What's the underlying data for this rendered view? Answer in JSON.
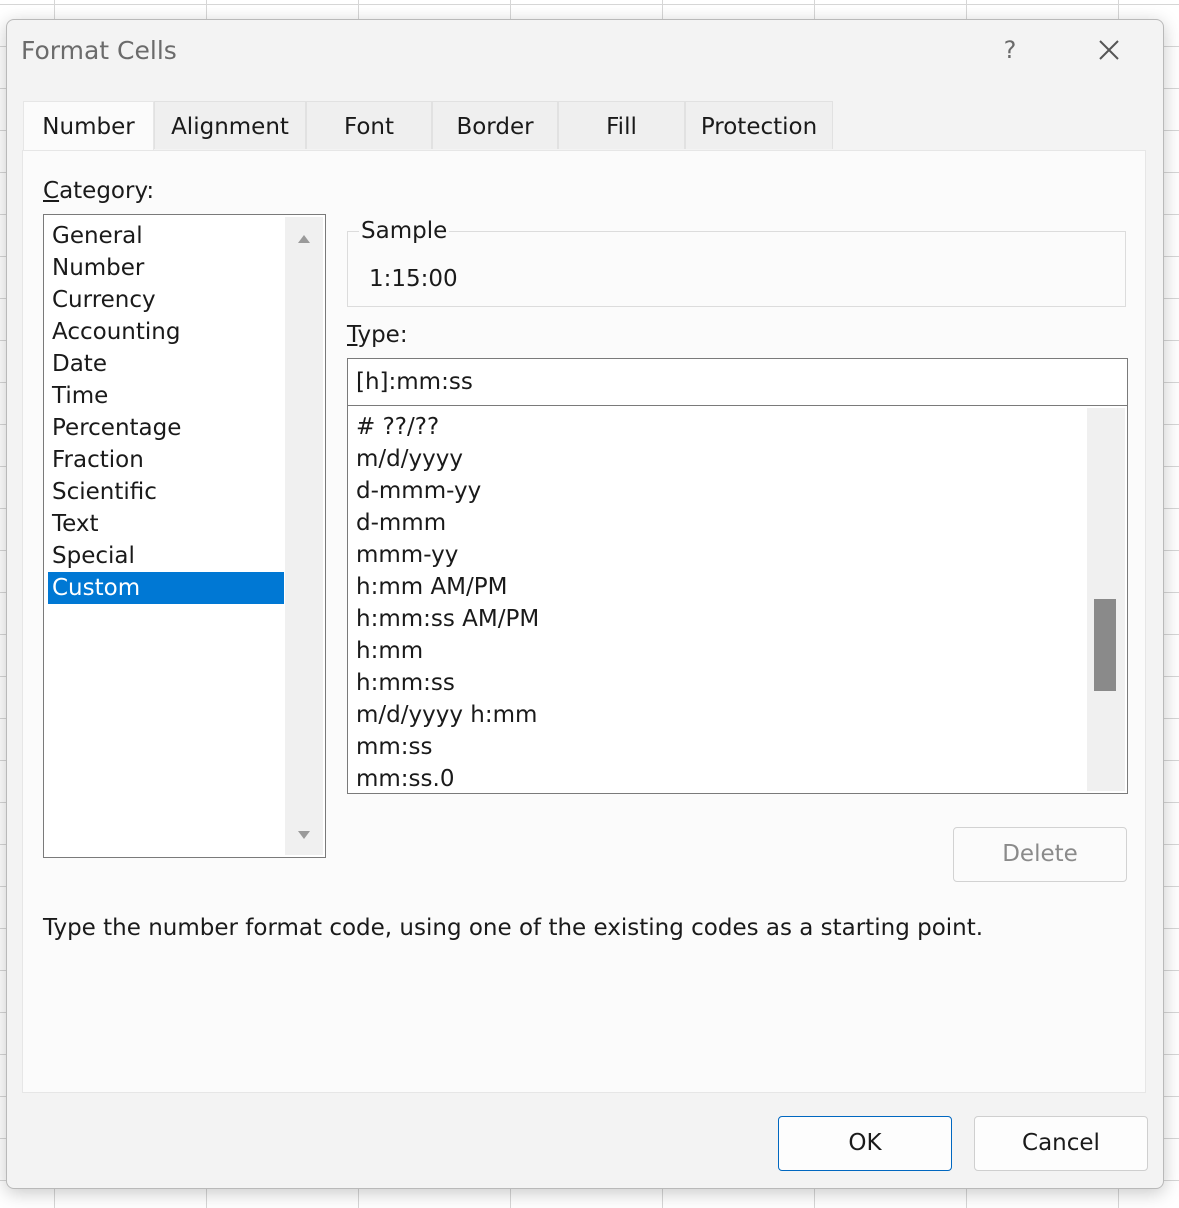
{
  "dialog": {
    "title": "Format Cells",
    "help_label": "?",
    "tabs": [
      "Number",
      "Alignment",
      "Font",
      "Border",
      "Fill",
      "Protection"
    ],
    "active_tab": "Number"
  },
  "category": {
    "label": "Category:",
    "items": [
      "General",
      "Number",
      "Currency",
      "Accounting",
      "Date",
      "Time",
      "Percentage",
      "Fraction",
      "Scientific",
      "Text",
      "Special",
      "Custom"
    ],
    "selected": "Custom"
  },
  "sample": {
    "label": "Sample",
    "value": "1:15:00"
  },
  "type": {
    "label": "Type:",
    "value": "[h]:mm:ss",
    "items": [
      "# ??/??",
      "m/d/yyyy",
      "d-mmm-yy",
      "d-mmm",
      "mmm-yy",
      "h:mm AM/PM",
      "h:mm:ss AM/PM",
      "h:mm",
      "h:mm:ss",
      "m/d/yyyy h:mm",
      "mm:ss",
      "mm:ss.0"
    ]
  },
  "buttons": {
    "delete": "Delete",
    "ok": "OK",
    "cancel": "Cancel"
  },
  "hint": "Type the number format code, using one of the existing codes as a starting point.",
  "colors": {
    "selection": "#0078d4",
    "dialog_bg": "#f3f3f3",
    "ok_border": "#0067c0"
  }
}
